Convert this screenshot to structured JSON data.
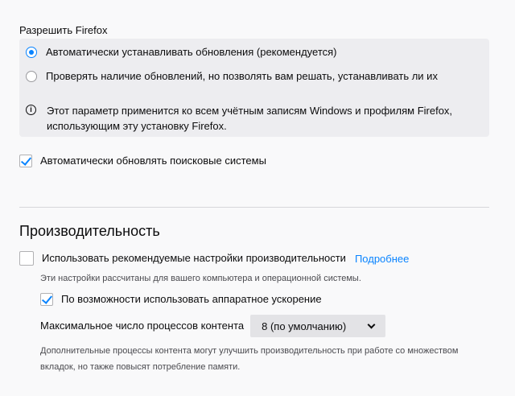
{
  "updates": {
    "allow_label": "Разрешить Firefox",
    "options": [
      {
        "label": "Автоматически устанавливать обновления (рекомендуется)",
        "checked": true
      },
      {
        "label": "Проверять наличие обновлений, но позволять вам решать, устанавливать ли их",
        "checked": false
      }
    ],
    "info_text": "Этот параметр применится ко всем учётным записям Windows и профилям Firefox, использующим эту установку Firefox."
  },
  "search_engines": {
    "label": "Автоматически обновлять поисковые системы",
    "checked": true
  },
  "performance": {
    "title": "Производительность",
    "recommended_label": "Использовать рекомендуемые настройки производительности",
    "recommended_checked": false,
    "more_link": "Подробнее",
    "recommended_hint": "Эти настройки рассчитаны для вашего компьютера и операционной системы.",
    "accel_label": "По возможности использовать аппаратное ускорение",
    "accel_checked": true,
    "processes_label": "Максимальное число процессов контента",
    "processes_value": "8 (по умолчанию)",
    "processes_hint": "Дополнительные процессы контента могут улучшить производительность при работе со множеством вкладок, но также повысят потребление памяти."
  },
  "colors": {
    "accent": "#0a84ff",
    "box_bg": "#ededf0",
    "page_bg": "#f9f9fa"
  }
}
